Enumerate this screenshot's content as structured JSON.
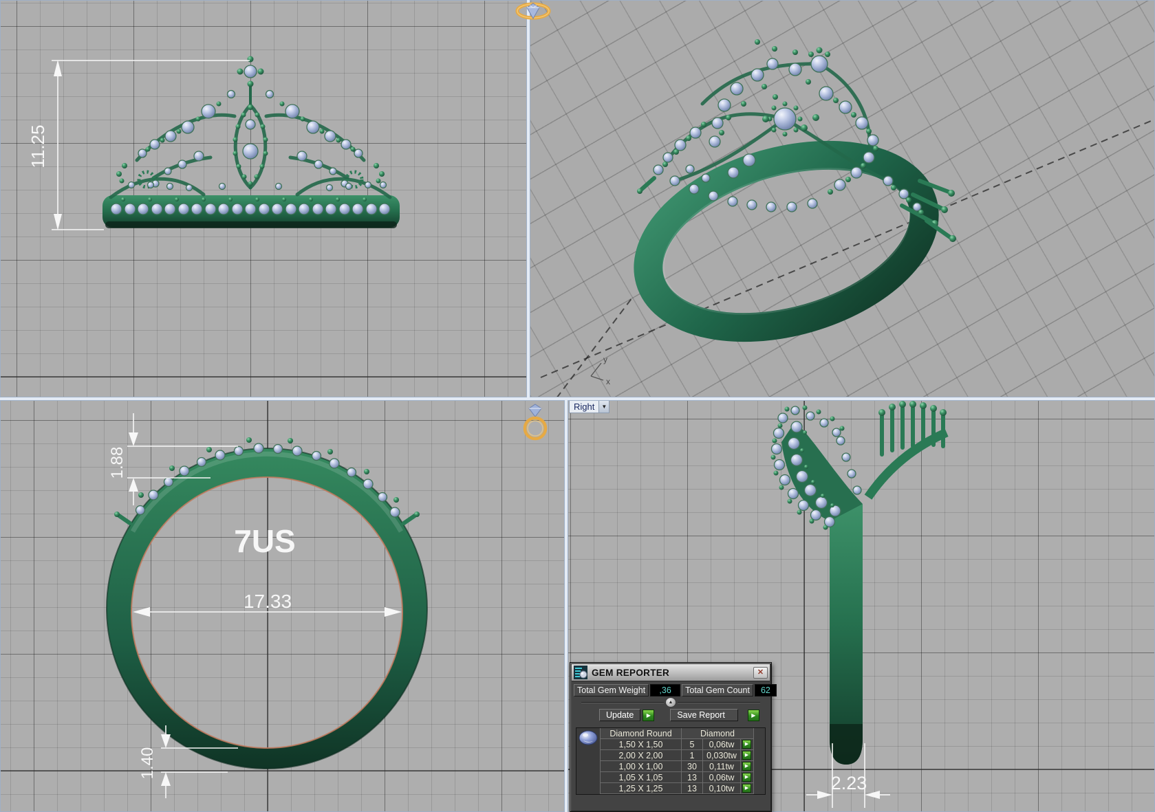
{
  "viewports": {
    "front": {
      "dim_height": "11.25"
    },
    "perspective": {
      "axis_y": "y",
      "axis_x": "x"
    },
    "side": {
      "ring_size": "7US",
      "dim_diameter": "17.33",
      "dim_top_thickness": "1.88",
      "dim_bottom_thickness": "1.40"
    },
    "right": {
      "label": "Right",
      "dim_band_width": "2.23"
    }
  },
  "icons": {
    "dropdown": "▼",
    "play": "▶",
    "close": "✕",
    "collapse": "▲"
  },
  "gem_reporter": {
    "title": "GEM REPORTER",
    "fields": {
      "weight_label": "Total Gem Weight",
      "weight_value": ",36",
      "count_label": "Total Gem Count",
      "count_value": "62"
    },
    "buttons": {
      "update": "Update",
      "save_report": "Save Report"
    },
    "table": {
      "headers": {
        "cut": "Diamond Round",
        "material": "Diamond"
      },
      "rows": [
        {
          "size": "1,50 X 1,50",
          "count": "5",
          "weight": "0,06tw"
        },
        {
          "size": "2,00 X 2,00",
          "count": "1",
          "weight": "0,030tw"
        },
        {
          "size": "1,00 X 1,00",
          "count": "30",
          "weight": "0,11tw"
        },
        {
          "size": "1,05 X 1,05",
          "count": "13",
          "weight": "0,06tw"
        },
        {
          "size": "1,25 X 1,25",
          "count": "13",
          "weight": "0,10tw"
        }
      ]
    }
  },
  "colors": {
    "metal_green": "#2e8160",
    "gem_blue": "#b9c6e2",
    "accent_orange": "#e9aa3f",
    "value_teal": "#63d5cb",
    "button_green": "#2f8a1f"
  }
}
